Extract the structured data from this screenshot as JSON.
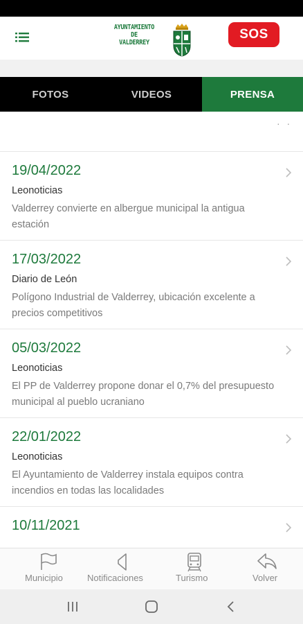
{
  "header": {
    "logo_line1": "AYUNTAMIENTO",
    "logo_line2": "DE",
    "logo_line3": "VALDERREY",
    "sos_label": "SOS"
  },
  "tabs": [
    {
      "label": "FOTOS",
      "active": false
    },
    {
      "label": "VIDEOS",
      "active": false
    },
    {
      "label": "PRENSA",
      "active": true
    }
  ],
  "news": [
    {
      "date": "19/04/2022",
      "source": "Leonoticias",
      "title": "Valderrey convierte en albergue municipal la antigua estación"
    },
    {
      "date": "17/03/2022",
      "source": "Diario de León",
      "title": "Polígono Industrial de Valderrey, ubicación excelente a precios competitivos"
    },
    {
      "date": "05/03/2022",
      "source": "Leonoticias",
      "title": "El PP de Valderrey propone donar el 0,7% del presupuesto municipal al pueblo ucraniano"
    },
    {
      "date": "22/01/2022",
      "source": "Leonoticias",
      "title": "El Ayuntamiento de Valderrey instala equipos contra incendios en todas las localidades"
    },
    {
      "date": "10/11/2021",
      "source": "",
      "title": ""
    }
  ],
  "bottom_nav": [
    {
      "label": "Municipio",
      "icon": "flag-icon"
    },
    {
      "label": "Notificaciones",
      "icon": "megaphone-icon"
    },
    {
      "label": "Turismo",
      "icon": "train-icon"
    },
    {
      "label": "Volver",
      "icon": "back-arrow-icon"
    }
  ],
  "colors": {
    "accent": "#1e7a3c",
    "sos": "#e21b23",
    "tab_bar": "#000000"
  }
}
